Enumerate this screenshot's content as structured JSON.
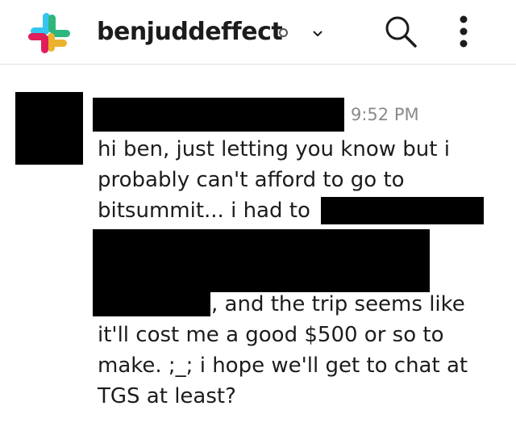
{
  "header": {
    "workspace_name": "benjuddeffect",
    "icons": [
      "slack-logo-icon",
      "presence-status-icon",
      "chevron-down-icon",
      "search-icon",
      "more-vertical-icon"
    ],
    "logo_colors": [
      "#36c5f0",
      "#2eb67d",
      "#ecb22e",
      "#e01e5a"
    ]
  },
  "message": {
    "timestamp": "9:52 PM",
    "lines": [
      "hi ben, just letting you know but i",
      "probably can't afford to go to",
      "bitsummit... i had to",
      ", and the trip seems like",
      "it'll cost me a good $500 or so to",
      "make. ;_; i hope we'll get to chat at",
      "TGS at least?"
    ]
  }
}
